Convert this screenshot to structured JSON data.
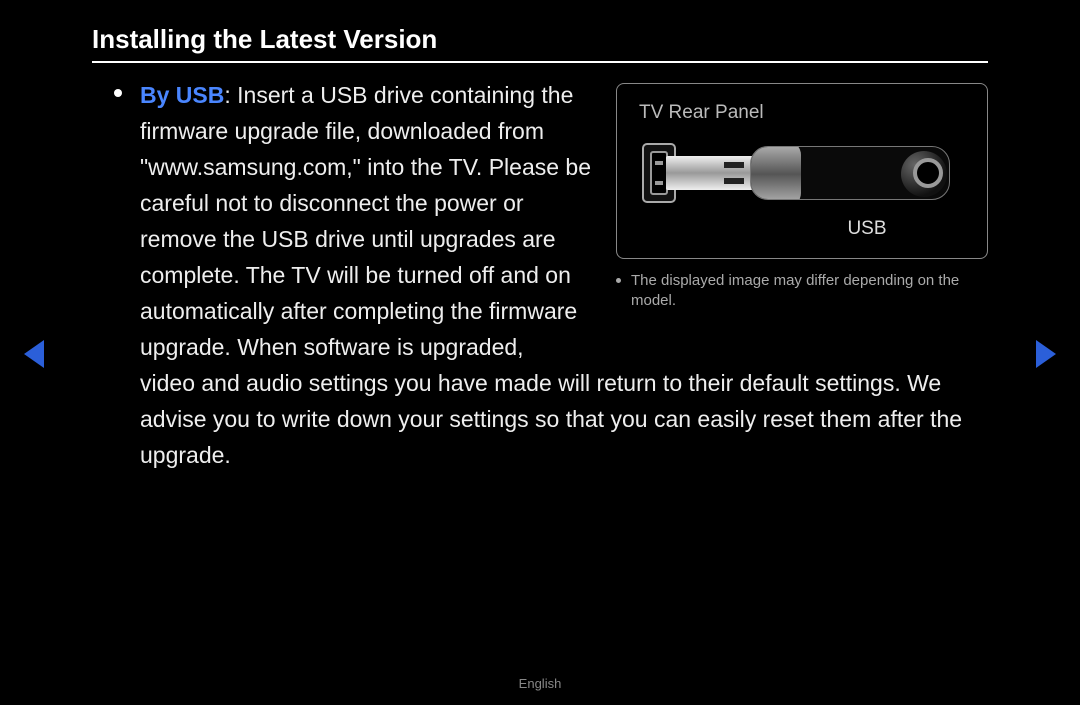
{
  "heading": "Installing the Latest Version",
  "highlight_label": "By USB",
  "body_part1": ": Insert a USB drive containing the firmware upgrade file, downloaded from \"www.samsung.com,\" into the TV. Please be careful not to disconnect the power or remove the USB drive until upgrades are complete. The TV will be turned off and on automatically after completing the firmware upgrade. When software is upgraded,",
  "body_part2": "video and audio settings you have made will return to their default settings. We advise you to write down your settings so that you can easily reset them after the upgrade.",
  "panel": {
    "title": "TV Rear Panel",
    "usb_label": "USB"
  },
  "note": "The displayed image may differ depending on the model.",
  "footer": "English"
}
